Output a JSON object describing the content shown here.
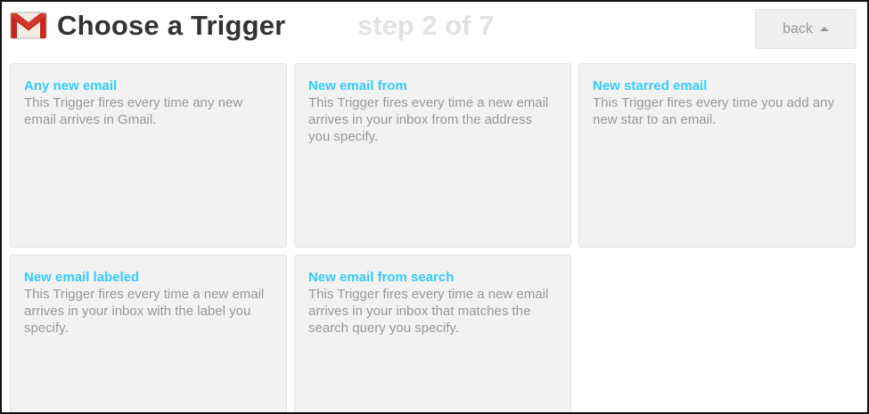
{
  "header": {
    "title": "Choose a Trigger",
    "step": "step 2 of 7",
    "back_label": "back",
    "logo_icon": "gmail-icon",
    "back_icon": "caret-up-icon"
  },
  "colors": {
    "card_title": "#33ccff",
    "card_text": "#999999",
    "card_bg": "#f2f2f2",
    "title": "#333333",
    "step": "#e2e2e2"
  },
  "triggers": [
    {
      "title": "Any new email",
      "description": "This Trigger fires every time any new email arrives in Gmail."
    },
    {
      "title": "New email from",
      "description": "This Trigger fires every time a new email arrives in your inbox from the address you specify."
    },
    {
      "title": "New starred email",
      "description": "This Trigger fires every time you add any new star to an email."
    },
    {
      "title": "New email labeled",
      "description": "This Trigger fires every time a new email arrives in your inbox with the label you specify."
    },
    {
      "title": "New email from search",
      "description": "This Trigger fires every time a new email arrives in your inbox that matches the search query you specify."
    }
  ]
}
